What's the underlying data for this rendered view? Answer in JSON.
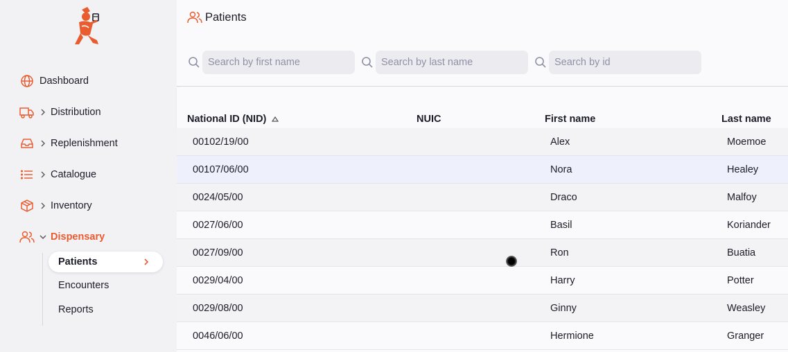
{
  "colors": {
    "accent": "#e95c30",
    "sidebar_bg": "#f2f2f5",
    "hover_row": "#eef1fb"
  },
  "sidebar": {
    "logo_icon": "app-logo-runner",
    "items": [
      {
        "label": "Dashboard",
        "icon": "globe-icon"
      },
      {
        "label": "Distribution",
        "icon": "truck-icon"
      },
      {
        "label": "Replenishment",
        "icon": "inbox-icon"
      },
      {
        "label": "Catalogue",
        "icon": "list-icon"
      },
      {
        "label": "Inventory",
        "icon": "box-icon"
      },
      {
        "label": "Dispensary",
        "icon": "users-icon"
      }
    ],
    "subitems": [
      {
        "label": "Patients"
      },
      {
        "label": "Encounters"
      },
      {
        "label": "Reports"
      }
    ]
  },
  "header": {
    "title": "Patients",
    "search": [
      {
        "placeholder": "Search by first name"
      },
      {
        "placeholder": "Search by last name"
      },
      {
        "placeholder": "Search by id"
      }
    ]
  },
  "table": {
    "columns": [
      "National ID (NID)",
      "NUIC",
      "First name",
      "Last name"
    ],
    "rows": [
      {
        "nid": "00102/19/00",
        "nuic": "",
        "first": "Alex",
        "last": "Moemoe"
      },
      {
        "nid": "00107/06/00",
        "nuic": "",
        "first": "Nora",
        "last": "Healey"
      },
      {
        "nid": "0024/05/00",
        "nuic": "",
        "first": "Draco",
        "last": "Malfoy"
      },
      {
        "nid": "0027/06/00",
        "nuic": "",
        "first": "Basil",
        "last": "Koriander"
      },
      {
        "nid": "0027/09/00",
        "nuic": "",
        "first": "Ron",
        "last": "Buatia"
      },
      {
        "nid": "0029/04/00",
        "nuic": "",
        "first": "Harry",
        "last": "Potter"
      },
      {
        "nid": "0029/08/00",
        "nuic": "",
        "first": "Ginny",
        "last": "Weasley"
      },
      {
        "nid": "0046/06/00",
        "nuic": "",
        "first": "Hermione",
        "last": "Granger"
      }
    ]
  }
}
